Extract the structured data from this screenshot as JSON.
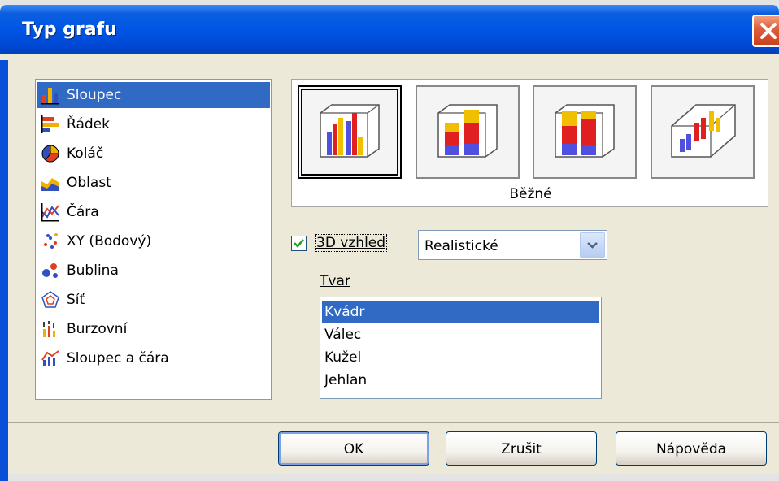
{
  "window": {
    "title": "Typ grafu"
  },
  "chart_types": [
    {
      "label": "Sloupec",
      "icon": "column-chart-icon",
      "selected": true
    },
    {
      "label": "Řádek",
      "icon": "bar-chart-icon",
      "selected": false
    },
    {
      "label": "Koláč",
      "icon": "pie-chart-icon",
      "selected": false
    },
    {
      "label": "Oblast",
      "icon": "area-chart-icon",
      "selected": false
    },
    {
      "label": "Čára",
      "icon": "line-chart-icon",
      "selected": false
    },
    {
      "label": "XY (Bodový)",
      "icon": "scatter-chart-icon",
      "selected": false
    },
    {
      "label": "Bublina",
      "icon": "bubble-chart-icon",
      "selected": false
    },
    {
      "label": "Síť",
      "icon": "net-chart-icon",
      "selected": false
    },
    {
      "label": "Burzovní",
      "icon": "stock-chart-icon",
      "selected": false
    },
    {
      "label": "Sloupec a čára",
      "icon": "column-line-chart-icon",
      "selected": false
    }
  ],
  "variants": {
    "selected_index": 0,
    "label": "Běžné",
    "items": [
      {
        "icon": "normal-column-3d-icon"
      },
      {
        "icon": "stacked-column-3d-icon"
      },
      {
        "icon": "percent-stacked-column-3d-icon"
      },
      {
        "icon": "deep-column-3d-icon"
      }
    ]
  },
  "look3d": {
    "checked": true,
    "label": "3D vzhled",
    "scheme_value": "Realistické"
  },
  "shape": {
    "label": "Tvar",
    "items": [
      {
        "label": "Kvádr",
        "selected": true
      },
      {
        "label": "Válec",
        "selected": false
      },
      {
        "label": "Kužel",
        "selected": false
      },
      {
        "label": "Jehlan",
        "selected": false
      }
    ]
  },
  "buttons": {
    "ok": "OK",
    "cancel": "Zrušit",
    "help": "Nápověda"
  },
  "colors": {
    "selection": "#316ac5",
    "titlebar": "#0055e5",
    "dialog_bg": "#ece9d8"
  }
}
